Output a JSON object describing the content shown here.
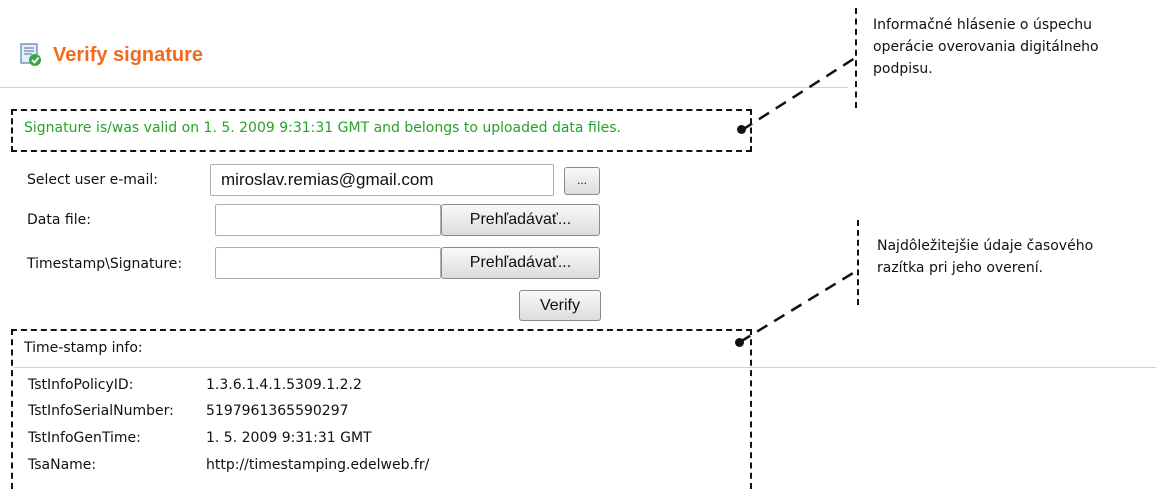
{
  "header": {
    "title": "Verify signature",
    "icon": "document-check-icon",
    "title_color": "#f26a1b"
  },
  "status": {
    "message": "Signature is/was valid on 1. 5. 2009 9:31:31 GMT and belongs to uploaded data files.",
    "color": "#2aa02a"
  },
  "form": {
    "email_label": "Select user e-mail:",
    "email_value": "miroslav.remias@gmail.com",
    "browse_email_label": "...",
    "data_file_label": "Data file:",
    "data_file_value": "",
    "data_file_browse_label": "Prehľadávať...",
    "timestamp_label": "Timestamp\\Signature:",
    "timestamp_value": "",
    "timestamp_browse_label": "Prehľadávať...",
    "verify_label": "Verify"
  },
  "timestamp_info": {
    "heading": "Time-stamp info:",
    "rows": [
      {
        "key": "TstInfoPolicyID:",
        "value": "1.3.6.1.4.1.5309.1.2.2"
      },
      {
        "key": "TstInfoSerialNumber:",
        "value": "5197961365590297"
      },
      {
        "key": "TstInfoGenTime:",
        "value": "1. 5. 2009 9:31:31 GMT"
      },
      {
        "key": "TsaName:",
        "value": "http://timestamping.edelweb.fr/"
      }
    ]
  },
  "annotations": {
    "note1_lines": [
      "Informačné hlásenie o úspechu",
      "operácie overovania digitálneho",
      "podpisu."
    ],
    "note2_lines": [
      "Najdôležitejšie údaje časového",
      "razítka pri jeho overení."
    ]
  }
}
